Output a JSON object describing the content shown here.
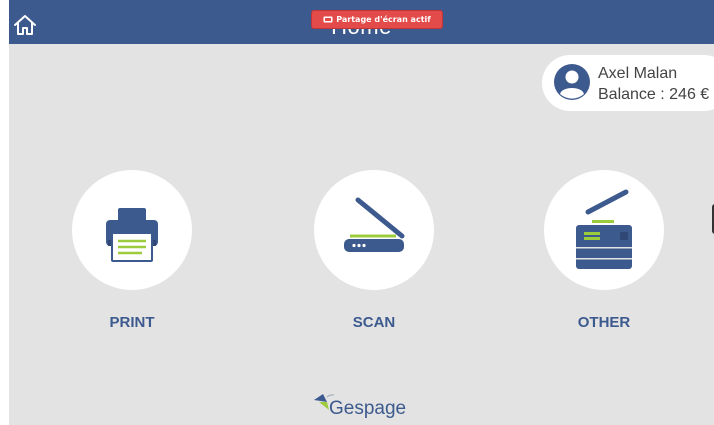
{
  "header": {
    "title": "Home",
    "share_badge": "Partage d'écran actif"
  },
  "user": {
    "name": "Axel Malan",
    "balance": "Balance : 246 €"
  },
  "tiles": [
    {
      "label": "PRINT",
      "icon": "printer-icon"
    },
    {
      "label": "SCAN",
      "icon": "scanner-icon"
    },
    {
      "label": "OTHER",
      "icon": "copier-icon"
    }
  ],
  "footer": {
    "logo_text": "Gespage"
  },
  "colors": {
    "brand": "#3d5a8e",
    "background": "#e3e3e3",
    "accent_green": "#9ccc3c",
    "badge_red": "#e34b4b"
  }
}
